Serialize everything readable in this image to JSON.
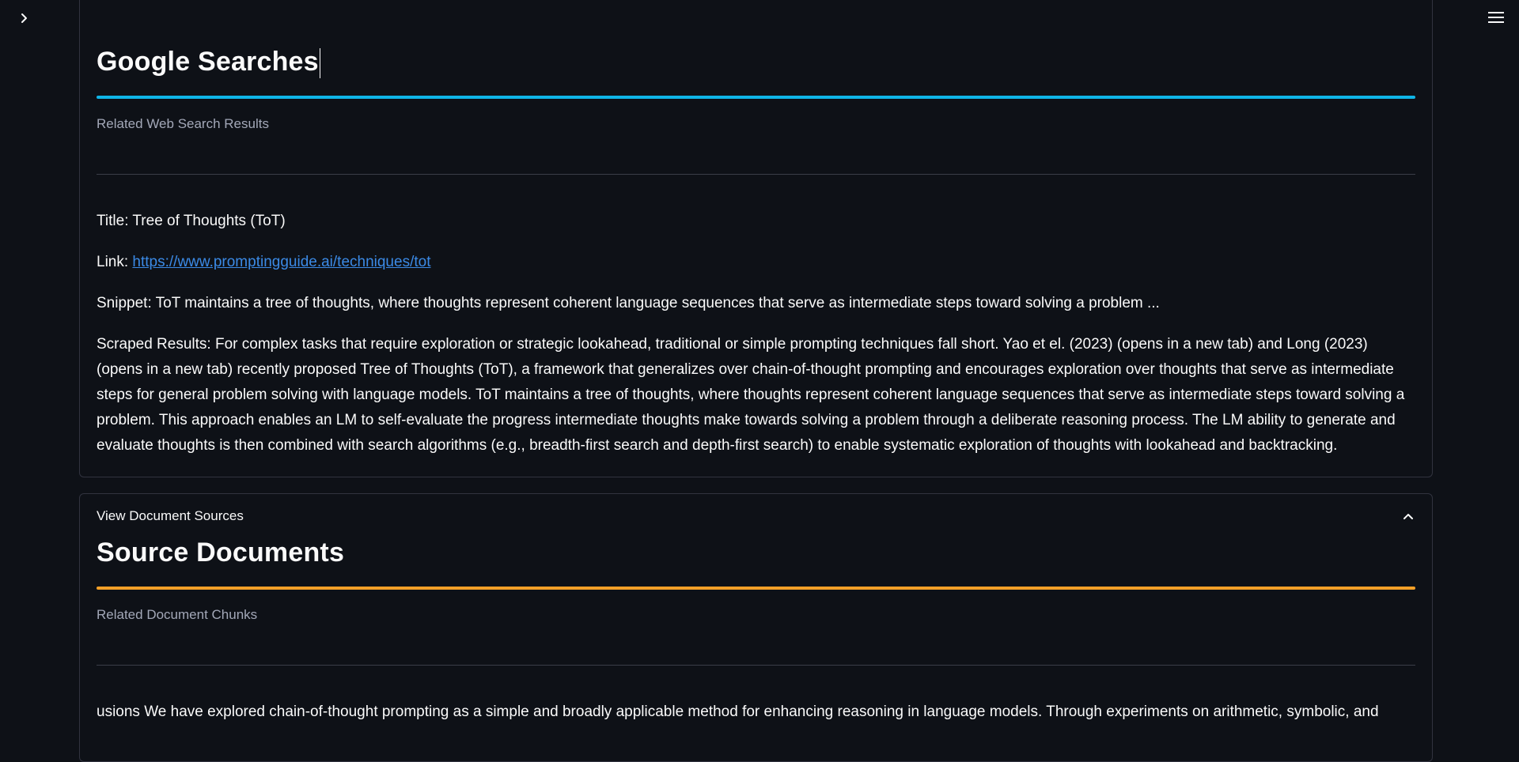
{
  "icons": {
    "sidebar_toggle": "chevron-right-icon",
    "main_menu": "hamburger-menu-icon",
    "expander_toggle": "chevron-up-icon"
  },
  "colors": {
    "background": "#0e1117",
    "google_rule": "#0fb5e7",
    "source_rule": "#f4a028",
    "link": "#3b8ae6"
  },
  "google_section": {
    "title": "Google Searches",
    "caption": "Related Web Search Results",
    "result": {
      "title_label": "Title:",
      "title_value": "Tree of Thoughts (ToT)",
      "link_label": "Link:",
      "link_value": "https://www.promptingguide.ai/techniques/tot",
      "snippet_label": "Snippet:",
      "snippet_value": "ToT maintains a tree of thoughts, where thoughts represent coherent language sequences that serve as intermediate steps toward solving a problem ...",
      "scraped_label": "Scraped Results:",
      "scraped_value": "For complex tasks that require exploration or strategic lookahead, traditional or simple prompting techniques fall short. Yao et el. (2023) (opens in a new tab) and Long (2023) (opens in a new tab) recently proposed Tree of Thoughts (ToT), a framework that generalizes over chain-of-thought prompting and encourages exploration over thoughts that serve as intermediate steps for general problem solving with language models. ToT maintains a tree of thoughts, where thoughts represent coherent language sequences that serve as intermediate steps toward solving a problem. This approach enables an LM to self-evaluate the progress intermediate thoughts make towards solving a problem through a deliberate reasoning process. The LM ability to generate and evaluate thoughts is then combined with search algorithms (e.g., breadth-first search and depth-first search) to enable systematic exploration of thoughts with lookahead and backtracking."
    }
  },
  "document_expander": {
    "label": "View Document Sources",
    "title": "Source Documents",
    "caption": "Related Document Chunks",
    "chunk_text": "usions We have explored chain-of-thought prompting as a simple and broadly applicable method for enhancing reasoning in language models. Through experiments on arithmetic, symbolic, and"
  }
}
